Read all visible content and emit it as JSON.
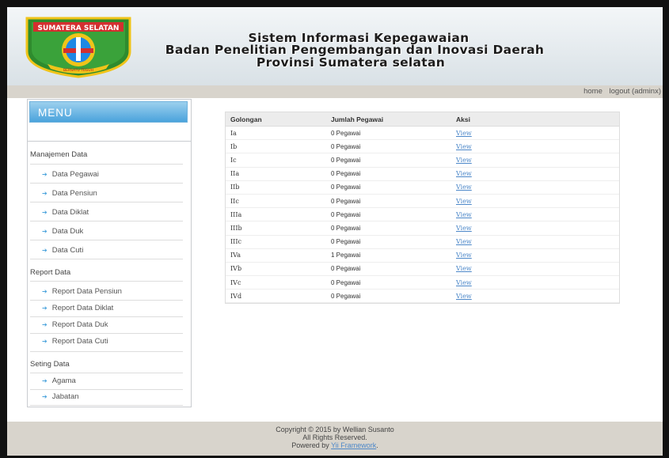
{
  "header": {
    "line1": "Sistem Informasi Kepegawaian",
    "line2": "Badan Penelitian Pengembangan dan Inovasi Daerah",
    "line3": "Provinsi Sumatera selatan",
    "logo_text": "SUMATERA SELATAN",
    "logo_motto": "BERSATU TEGUH"
  },
  "topnav": {
    "home": "home",
    "logout": "logout (adminx)"
  },
  "sidebar": {
    "menu_title": "MENU",
    "sections": [
      {
        "title": "Manajemen Data",
        "items": [
          "Data Pegawai",
          "Data Pensiun",
          "Data Diklat",
          "Data Duk",
          "Data Cuti"
        ]
      },
      {
        "title": "Report Data",
        "items": [
          "Report Data Pensiun",
          "Report Data Diklat",
          "Report Data Duk",
          "Report Data Cuti"
        ]
      },
      {
        "title": "Seting Data",
        "items": [
          "Agama",
          "Jabatan"
        ]
      }
    ]
  },
  "table": {
    "headers": [
      "Golongan",
      "Jumlah Pegawai",
      "Aksi"
    ],
    "rows": [
      [
        "Ia",
        "0 Pegawai",
        "View"
      ],
      [
        "Ib",
        "0 Pegawai",
        "View"
      ],
      [
        "Ic",
        "0 Pegawai",
        "View"
      ],
      [
        "IIa",
        "0 Pegawai",
        "View"
      ],
      [
        "IIb",
        "0 Pegawai",
        "View"
      ],
      [
        "IIc",
        "0 Pegawai",
        "View"
      ],
      [
        "IIIa",
        "0 Pegawai",
        "View"
      ],
      [
        "IIIb",
        "0 Pegawai",
        "View"
      ],
      [
        "IIIc",
        "0 Pegawai",
        "View"
      ],
      [
        "IVa",
        "1 Pegawai",
        "View"
      ],
      [
        "IVb",
        "0 Pegawai",
        "View"
      ],
      [
        "IVc",
        "0 Pegawai",
        "View"
      ],
      [
        "IVd",
        "0 Pegawai",
        "View"
      ]
    ]
  },
  "footer": {
    "copyright": "Copyright © 2015 by Wellian Susanto",
    "rights": "All Rights Reserved.",
    "powered_prefix": "Powered by ",
    "powered_link": "Yii Framework",
    "powered_suffix": "."
  },
  "colors": {
    "accent": "#4aa3dc",
    "link": "#4d88c9",
    "footer_bg": "#d8d4cc"
  }
}
